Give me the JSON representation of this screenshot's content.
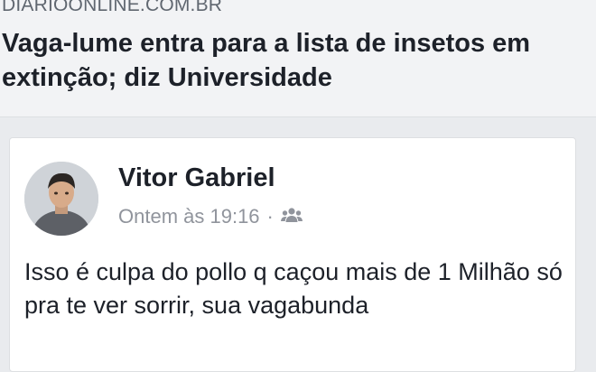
{
  "link_preview": {
    "domain": "DIARIOONLINE.COM.BR",
    "title": "Vaga-lume entra para a lista de insetos em extinção; diz Universidade"
  },
  "comment": {
    "author": "Vitor Gabriel",
    "timestamp": "Ontem às 19:16",
    "separator": "·",
    "privacy_icon": "friends-icon",
    "text": "Isso é culpa do pollo q caçou mais de 1 Milhão só pra te ver sorrir, sua vagabunda"
  }
}
